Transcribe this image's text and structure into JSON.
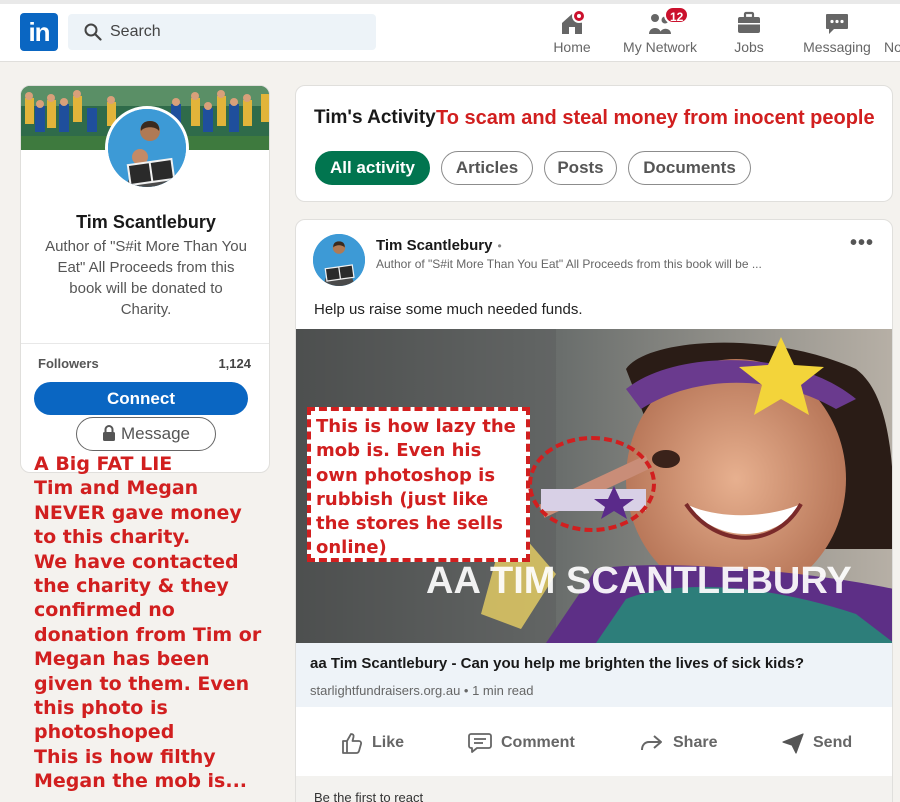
{
  "nav": {
    "search_placeholder": "Search",
    "items": [
      {
        "label": "Home",
        "icon": "home-icon"
      },
      {
        "label": "My Network",
        "icon": "network-icon",
        "badge": "12"
      },
      {
        "label": "Jobs",
        "icon": "briefcase-icon"
      },
      {
        "label": "Messaging",
        "icon": "messaging-icon"
      },
      {
        "label": "No",
        "icon": "bell-icon"
      }
    ],
    "logo_text": "in",
    "brand_color": "#0a66c2"
  },
  "profile": {
    "name": "Tim Scantlebury",
    "tagline": "Author of \"S#it More Than You Eat\" All Proceeds from this book will be donated to Charity.",
    "followers_label": "Followers",
    "followers_count": "1,124",
    "connect_label": "Connect",
    "message_label": "Message"
  },
  "activity": {
    "title": "Tim's Activity",
    "filters": [
      {
        "label": "All activity",
        "active": true
      },
      {
        "label": "Articles",
        "active": false
      },
      {
        "label": "Posts",
        "active": false
      },
      {
        "label": "Documents",
        "active": false
      }
    ]
  },
  "post": {
    "author": "Tim Scantlebury",
    "author_dot": "•",
    "subtitle": "Author of \"S#it More Than You Eat\" All Proceeds from this book will be ...",
    "text": "Help us raise some much needed funds.",
    "image_caption": "AA TIM SCANTLEBURY",
    "link_title": "aa Tim Scantlebury - Can you help me brighten the lives of sick kids?",
    "link_meta": "starlightfundraisers.org.au • 1 min read",
    "actions": [
      "Like",
      "Comment",
      "Share",
      "Send"
    ],
    "first_react": "Be the first to react"
  },
  "annotations": {
    "title_note": "To scam and steal money from inocent people",
    "left_note": [
      "A Big FAT LIE",
      "Tim and Megan",
      "NEVER gave money",
      "to this charity.",
      "We have contacted",
      "the charity & they",
      "confirmed no",
      "donation from Tim or",
      "Megan has been",
      "given to them. Even",
      "this photo is",
      "photoshoped",
      "This is how filthy",
      "Megan the mob is..."
    ],
    "box_note": [
      "This is how lazy the",
      "mob is. Even his",
      "own photoshop is",
      "rubbish (just like",
      "the stores he sells",
      "online)"
    ],
    "annotation_color": "#d11f1f"
  }
}
